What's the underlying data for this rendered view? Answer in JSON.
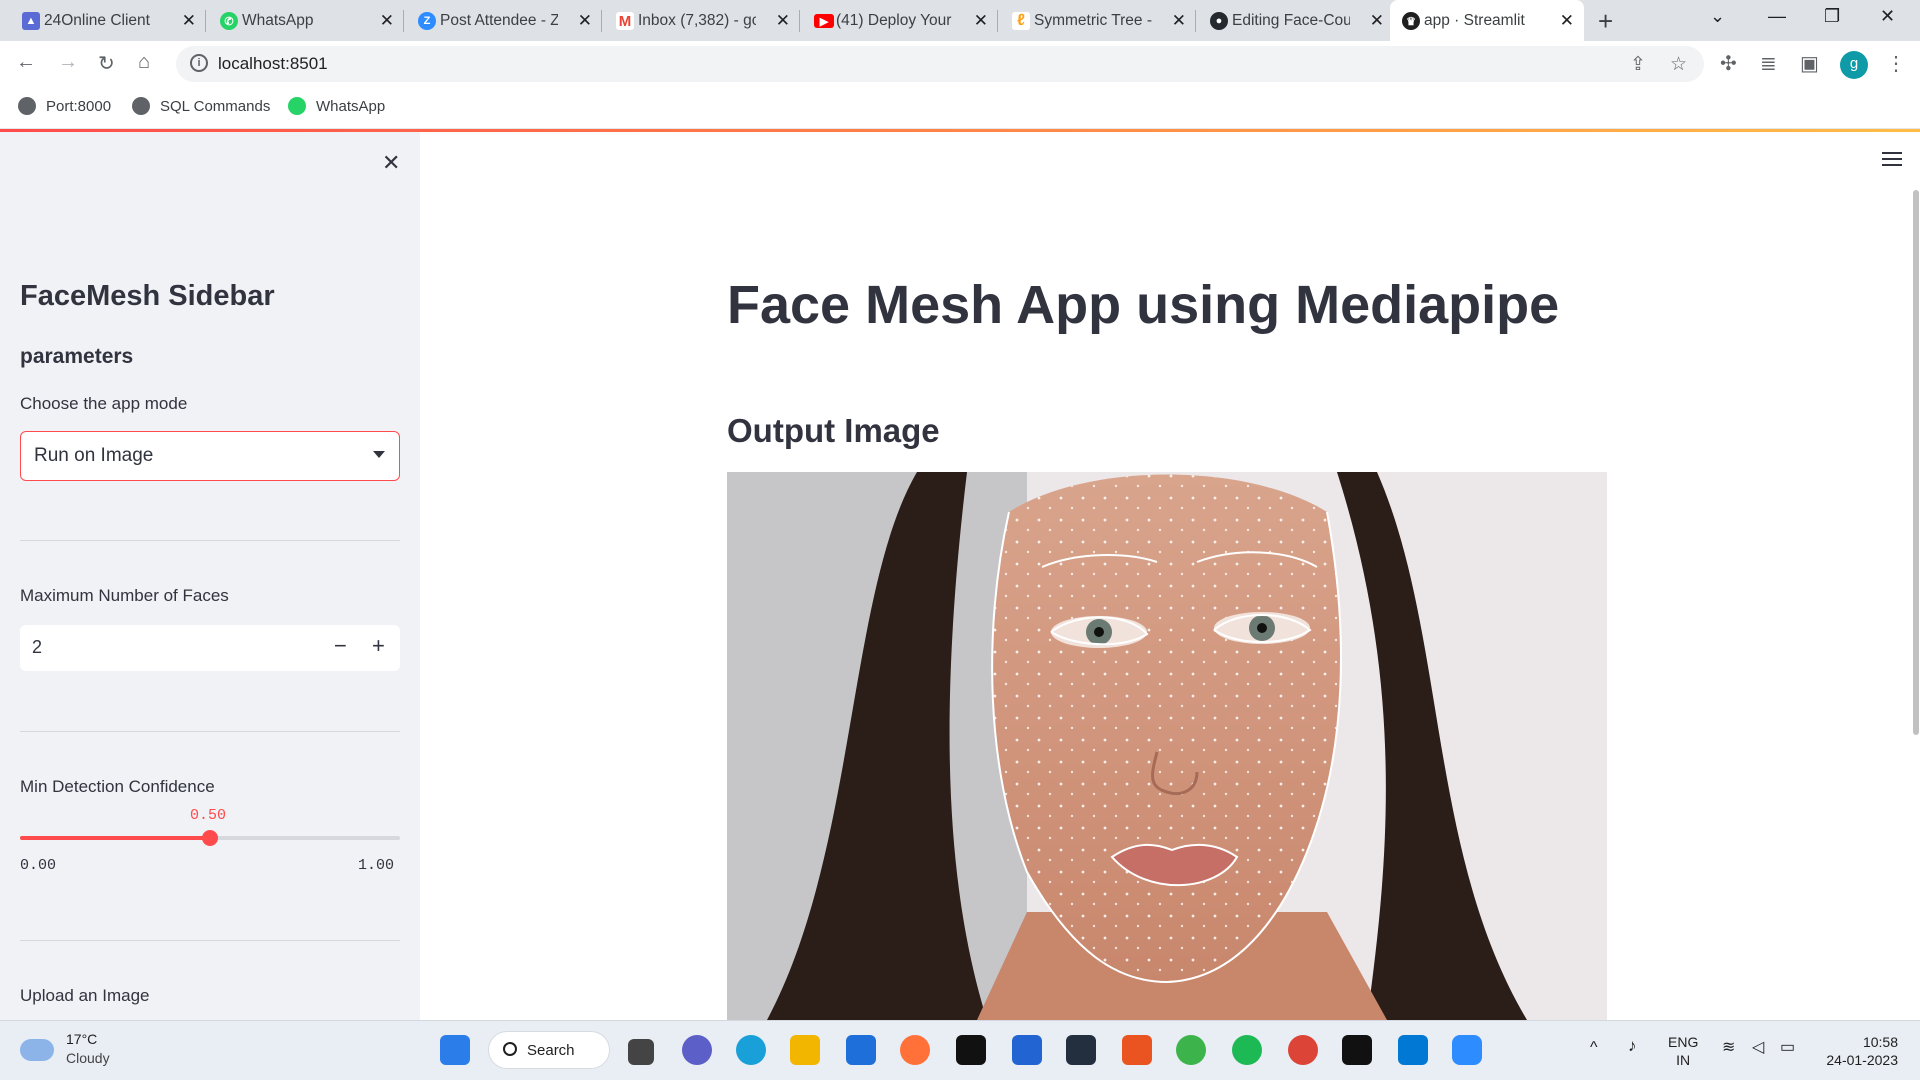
{
  "browser": {
    "tabs": [
      {
        "title": "24Online Client",
        "icon": "24online-icon",
        "color": "#5b6bd6"
      },
      {
        "title": "WhatsApp",
        "icon": "whatsapp-icon",
        "color": "#25d366"
      },
      {
        "title": "Post Attendee - Z",
        "icon": "zoom-icon",
        "color": "#2d8cff"
      },
      {
        "title": "Inbox (7,382) - gc",
        "icon": "gmail-icon",
        "color": "#ea4335"
      },
      {
        "title": "(41) Deploy Your",
        "icon": "youtube-icon",
        "color": "#ff0000"
      },
      {
        "title": "Symmetric Tree -",
        "icon": "leetcode-icon",
        "color": "#ffa116"
      },
      {
        "title": "Editing Face-Cour",
        "icon": "github-icon",
        "color": "#24292f"
      },
      {
        "title": "app · Streamlit",
        "icon": "streamlit-icon",
        "color": "#ff4b4b"
      }
    ],
    "url": "localhost:8501",
    "profile_initial": "g",
    "bookmarks": [
      {
        "label": "Port:8000",
        "icon": "globe-icon"
      },
      {
        "label": "SQL Commands",
        "icon": "globe-icon"
      },
      {
        "label": "WhatsApp",
        "icon": "whatsapp-icon"
      }
    ]
  },
  "sidebar": {
    "title": "FaceMesh Sidebar",
    "subtitle": "parameters",
    "mode_label": "Choose the app mode",
    "mode_value": "Run on Image",
    "faces_label": "Maximum Number of Faces",
    "faces_value": "2",
    "minus": "−",
    "plus": "+",
    "confidence_label": "Min Detection Confidence",
    "confidence_value": "0.50",
    "confidence_min": "0.00",
    "confidence_max": "1.00",
    "confidence_fraction": 0.5,
    "upload_label": "Upload an Image"
  },
  "main": {
    "title": "Face Mesh App using Mediapipe",
    "output_heading": "Output Image"
  },
  "taskbar": {
    "temperature": "17°C",
    "weather": "Cloudy",
    "search_label": "Search",
    "lang1": "ENG",
    "lang2": "IN",
    "time": "10:58",
    "date": "24-01-2023"
  },
  "colors": {
    "accent": "#ff4b4b",
    "sidebar_bg": "#f0f2f6",
    "text": "#31333f"
  }
}
